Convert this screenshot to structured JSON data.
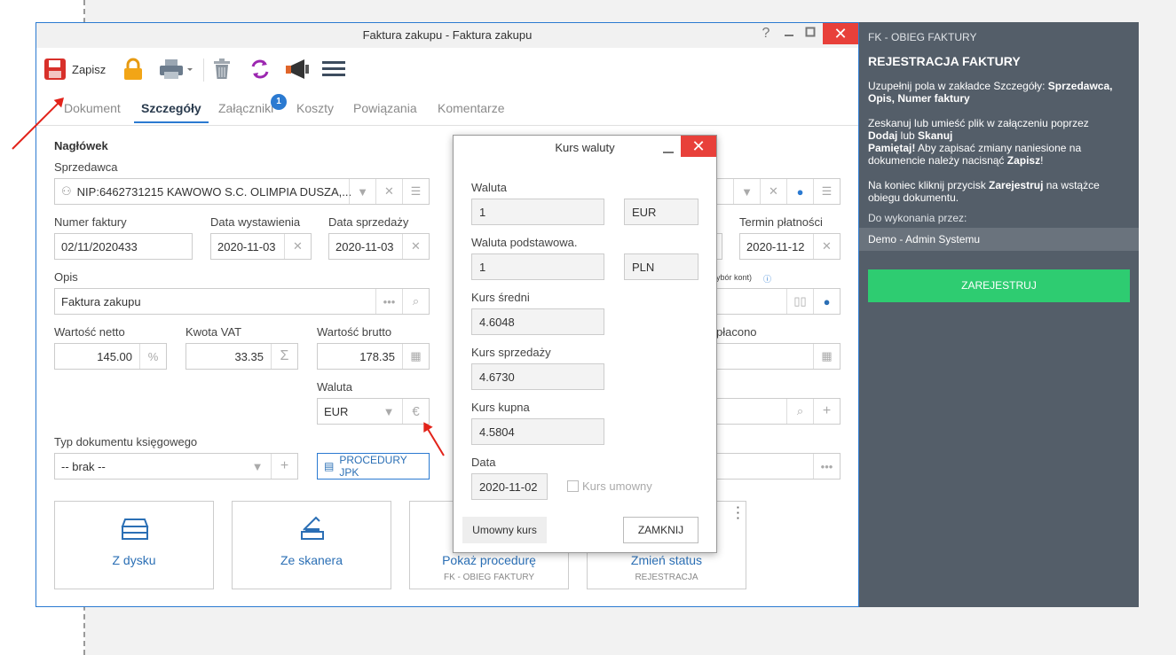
{
  "window": {
    "title": "Faktura zakupu - Faktura zakupu",
    "help": "?"
  },
  "toolbar": {
    "save_label": "Zapisz"
  },
  "tabs": [
    {
      "label": "Dokument"
    },
    {
      "label": "Szczegóły"
    },
    {
      "label": "Załączniki",
      "badge": "1"
    },
    {
      "label": "Koszty"
    },
    {
      "label": "Powiązania"
    },
    {
      "label": "Komentarze"
    }
  ],
  "form": {
    "header": "Nagłówek",
    "seller_label": "Sprzedawca",
    "seller_value": "NIP:6462731215 KAWOWO S.C. OLIMPIA DUSZA,...",
    "invoice_number_label": "Numer faktury",
    "invoice_number_value": "02/11/2020433",
    "issue_date_label": "Data wystawienia",
    "issue_date_value": "2020-11-03",
    "sale_date_label": "Data sprzedaży",
    "sale_date_value": "2020-11-03",
    "due_date_label": "Termin płatności",
    "due_date_value": "2020-11-12",
    "desc_label": "Opis",
    "desc_value": "Faktura zakupu",
    "accounts_hint": "ybór kont)",
    "net_label": "Wartość netto",
    "net_value": "145.00",
    "vat_label": "Kwota VAT",
    "vat_value": "33.35",
    "gross_label": "Wartość brutto",
    "gross_value": "178.35",
    "paid_label": "płacono",
    "currency_label": "Waluta",
    "currency_value": "EUR",
    "doctype_label": "Typ dokumentu księgowego",
    "doctype_value": "-- brak --",
    "jpk_button": "PROCEDURY JPK"
  },
  "tiles": [
    {
      "title": "Z dysku",
      "sub": ""
    },
    {
      "title": "Ze skanera",
      "sub": ""
    },
    {
      "title": "Pokaż procedurę",
      "sub": "FK - OBIEG FAKTURY"
    },
    {
      "title": "Zmień status",
      "sub": "REJESTRACJA"
    }
  ],
  "right_panel": {
    "header": "FK - OBIEG FAKTURY",
    "title": "REJESTRACJA FAKTURY",
    "p1_a": "Uzupełnij pola w zakładce Szczegóły: ",
    "p1_b": "Sprzedawca, Opis, Numer faktury",
    "p2_a": "Zeskanuj lub umieść plik w załączeniu poprzez ",
    "p2_b": "Dodaj",
    "p2_c": " lub ",
    "p2_d": "Skanuj",
    "p2_e": "Pamiętaj!",
    "p2_f": " Aby zapisać zmiany naniesione na dokumencie należy nacisnąć ",
    "p2_g": "Zapisz",
    "p2_h": "!",
    "p3_a": "Na koniec kliknij przycisk ",
    "p3_b": "Zarejestruj",
    "p3_c": " na wstążce obiegu dokumentu.",
    "todo_label": "Do wykonania przez:",
    "assignee": "Demo - Admin Systemu",
    "register_button": "ZAREJESTRUJ"
  },
  "dialog": {
    "title": "Kurs waluty",
    "currency_label": "Waluta",
    "currency_amount": "1",
    "currency_code": "EUR",
    "base_label": "Waluta podstawowa.",
    "base_amount": "1",
    "base_code": "PLN",
    "avg_label": "Kurs średni",
    "avg_value": "4.6048",
    "sell_label": "Kurs sprzedaży",
    "sell_value": "4.6730",
    "buy_label": "Kurs kupna",
    "buy_value": "4.5804",
    "date_label": "Data",
    "date_value": "2020-11-02",
    "contract_checkbox": "Kurs umowny",
    "contract_button": "Umowny kurs",
    "close_button": "ZAMKNIJ"
  }
}
